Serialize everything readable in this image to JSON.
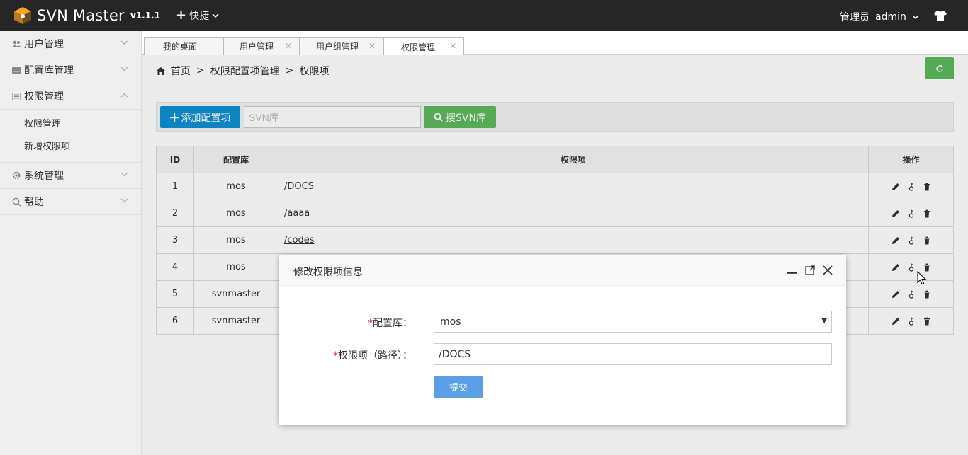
{
  "topbar": {
    "app_name": "SVN Master",
    "version": "v1.1.1",
    "quick_label": "快捷",
    "role_label": "管理员",
    "username": "admin"
  },
  "sidebar": {
    "items": [
      {
        "label": "用户管理",
        "icon": "users-icon"
      },
      {
        "label": "配置库管理",
        "icon": "database-icon"
      },
      {
        "label": "权限管理",
        "icon": "book-icon",
        "expanded": true,
        "children": [
          {
            "label": "权限管理"
          },
          {
            "label": "新增权限项"
          }
        ]
      },
      {
        "label": "系统管理",
        "icon": "gear-icon"
      },
      {
        "label": "帮助",
        "icon": "search-icon"
      }
    ]
  },
  "tabs": [
    {
      "label": "我的桌面",
      "closable": false
    },
    {
      "label": "用户管理",
      "closable": true
    },
    {
      "label": "用户组管理",
      "closable": true
    },
    {
      "label": "权限管理",
      "closable": true,
      "active": true
    }
  ],
  "breadcrumb": {
    "home": "首页",
    "sep": ">",
    "level1": "权限配置项管理",
    "level2": "权限项"
  },
  "toolbar": {
    "add_label": "添加配置项",
    "search_placeholder": "SVN库",
    "search_label": "搜SVN库"
  },
  "table": {
    "headers": [
      "ID",
      "配置库",
      "权限项",
      "操作"
    ],
    "rows": [
      {
        "id": "1",
        "repo": "mos",
        "path": "/DOCS"
      },
      {
        "id": "2",
        "repo": "mos",
        "path": "/aaaa"
      },
      {
        "id": "3",
        "repo": "mos",
        "path": "/codes"
      },
      {
        "id": "4",
        "repo": "mos",
        "path": ""
      },
      {
        "id": "5",
        "repo": "svnmaster",
        "path": ""
      },
      {
        "id": "6",
        "repo": "svnmaster",
        "path": ""
      }
    ]
  },
  "modal": {
    "title": "修改权限项信息",
    "repo_label": "配置库：",
    "repo_value": "mos",
    "path_label": "权限项（路径）：",
    "path_value": "/DOCS",
    "required_mark": "*",
    "submit_label": "提交"
  },
  "colors": {
    "topbar": "#262626",
    "primary": "#0e90d2",
    "success": "#5eb95e",
    "submit": "#5b9fe6"
  }
}
